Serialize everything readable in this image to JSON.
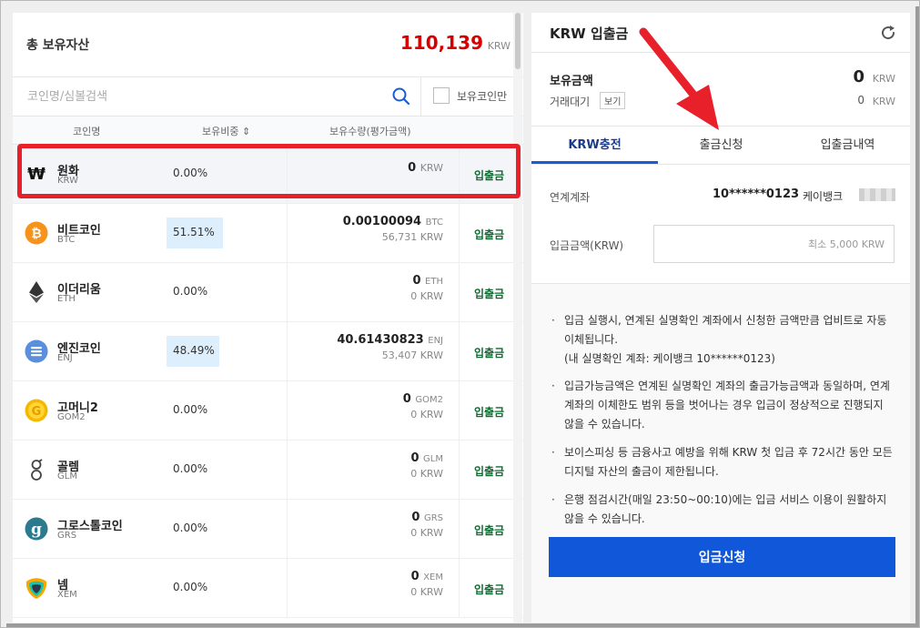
{
  "left_panel": {
    "total_label": "총 보유자산",
    "total_value": "110,139",
    "total_unit": "KRW",
    "search_placeholder": "코인명/심볼검색",
    "only_held_label": "보유코인만",
    "columns": {
      "coin": "코인명",
      "ratio": "보유비중 ⇕",
      "amount": "보유수량(평가금액)"
    },
    "rows": [
      {
        "name": "원화",
        "symbol": "KRW",
        "ratio": "0.00%",
        "ratio_value": 0,
        "amount": "0",
        "amount_unit": "KRW",
        "krw": "",
        "action": "입출금",
        "icon": "won-icon",
        "selected": true
      },
      {
        "name": "비트코인",
        "symbol": "BTC",
        "ratio": "51.51%",
        "ratio_value": 51.51,
        "amount": "0.00100094",
        "amount_unit": "BTC",
        "krw": "56,731 KRW",
        "action": "입출금",
        "icon": "bitcoin-icon"
      },
      {
        "name": "이더리움",
        "symbol": "ETH",
        "ratio": "0.00%",
        "ratio_value": 0,
        "amount": "0",
        "amount_unit": "ETH",
        "krw": "0 KRW",
        "action": "입출금",
        "icon": "ethereum-icon"
      },
      {
        "name": "엔진코인",
        "symbol": "ENJ",
        "ratio": "48.49%",
        "ratio_value": 48.49,
        "amount": "40.61430823",
        "amount_unit": "ENJ",
        "krw": "53,407 KRW",
        "action": "입출금",
        "icon": "enjin-icon"
      },
      {
        "name": "고머니2",
        "symbol": "GOM2",
        "ratio": "0.00%",
        "ratio_value": 0,
        "amount": "0",
        "amount_unit": "GOM2",
        "krw": "0 KRW",
        "action": "입출금",
        "icon": "gomoney-icon"
      },
      {
        "name": "골렘",
        "symbol": "GLM",
        "ratio": "0.00%",
        "ratio_value": 0,
        "amount": "0",
        "amount_unit": "GLM",
        "krw": "0 KRW",
        "action": "입출금",
        "icon": "golem-icon"
      },
      {
        "name": "그로스톨코인",
        "symbol": "GRS",
        "ratio": "0.00%",
        "ratio_value": 0,
        "amount": "0",
        "amount_unit": "GRS",
        "krw": "0 KRW",
        "action": "입출금",
        "icon": "groestl-icon"
      },
      {
        "name": "넴",
        "symbol": "XEM",
        "ratio": "0.00%",
        "ratio_value": 0,
        "amount": "0",
        "amount_unit": "XEM",
        "krw": "0 KRW",
        "action": "입출금",
        "icon": "nem-icon"
      }
    ]
  },
  "right_panel": {
    "title": "KRW 입출금",
    "balance_label": "보유금액",
    "balance_value": "0",
    "balance_unit": "KRW",
    "pending_label": "거래대기",
    "pending_button": "보기",
    "pending_value": "0",
    "pending_unit": "KRW",
    "tabs": [
      "KRW충전",
      "출금신청",
      "입출금내역"
    ],
    "account_label": "연계계좌",
    "account_number": "10******0123",
    "bank_name": "케이뱅크",
    "deposit_label": "입금금액(KRW)",
    "deposit_placeholder": "최소 5,000 KRW",
    "notes": [
      "입금 실행시, 연계된 실명확인 계좌에서 신청한 금액만큼 업비트로 자동 이체됩니다.",
      "(내 실명확인 계좌: 케이뱅크 10******0123)",
      "입금가능금액은 연계된 실명확인 계좌의 출금가능금액과 동일하며, 연계 계좌의 이체한도 범위 등을 벗어나는 경우 입금이 정상적으로 진행되지 않을 수 있습니다.",
      "보이스피싱 등 금융사고 예방을 위해 KRW 첫 입금 후 72시간 동안 모든 디지털 자산의 출금이 제한됩니다.",
      "은행 점검시간(매일 23:50~00:10)에는 입금 서비스 이용이 원활하지 않을 수 있습니다."
    ],
    "submit_label": "입금신청"
  },
  "colors": {
    "total_value": "#d60000",
    "action_green": "#116b33",
    "primary_blue": "#1157d9",
    "highlight_red": "#e8202a",
    "ratio_bar": "#ddeefc"
  }
}
